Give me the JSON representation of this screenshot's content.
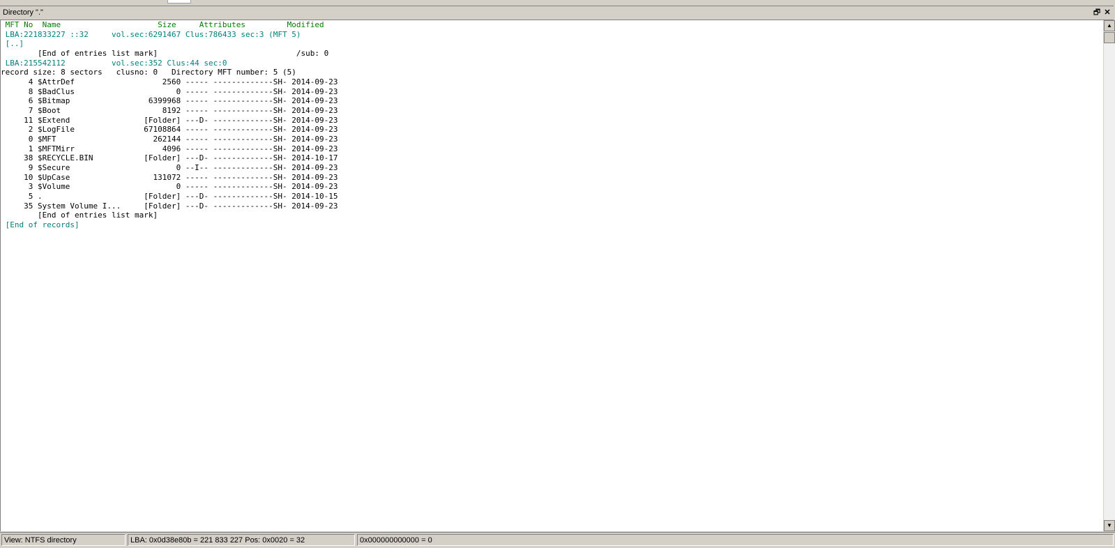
{
  "window": {
    "title": "Directory \".\"",
    "restore_glyph": "🗗",
    "close_glyph": "✕"
  },
  "listing": {
    "header": " MFT No  Name                     Size     Attributes         Modified",
    "lba_line1": " LBA:221833227 ::32     vol.sec:6291467 Clus:786433 sec:3 (MFT 5)",
    "parent": " [..]",
    "end_entries_1": "        [End of entries list mark]                              /sub: 0",
    "lba_line2": " LBA:215542112          vol.sec:352 Clus:44 sec:0",
    "record_info": "record size: 8 sectors   clusno: 0   Directory MFT number: 5 (5)",
    "rows": [
      {
        "text": "      4 $AttrDef                   2560 ----- -------------SH- 2014-09-23"
      },
      {
        "text": "      8 $BadClus                      0 ----- -------------SH- 2014-09-23"
      },
      {
        "text": "      6 $Bitmap                 6399968 ----- -------------SH- 2014-09-23"
      },
      {
        "text": "      7 $Boot                      8192 ----- -------------SH- 2014-09-23"
      },
      {
        "text": "     11 $Extend                [Folder] ---D- -------------SH- 2014-09-23"
      },
      {
        "text": "      2 $LogFile               67108864 ----- -------------SH- 2014-09-23"
      },
      {
        "text": "      0 $MFT                     262144 ----- -------------SH- 2014-09-23"
      },
      {
        "text": "      1 $MFTMirr                   4096 ----- -------------SH- 2014-09-23"
      },
      {
        "text": "     38 $RECYCLE.BIN           [Folder] ---D- -------------SH- 2014-10-17"
      },
      {
        "text": "      9 $Secure                       0 --I-- -------------SH- 2014-09-23"
      },
      {
        "text": "     10 $UpCase                  131072 ----- -------------SH- 2014-09-23"
      },
      {
        "text": "      3 $Volume                       0 ----- -------------SH- 2014-09-23"
      },
      {
        "text": "      5 .                      [Folder] ---D- -------------SH- 2014-10-15"
      },
      {
        "text": "     35 System Volume I...     [Folder] ---D- -------------SH- 2014-09-23"
      }
    ],
    "end_entries_2": "        [End of entries list mark]",
    "end_records": " [End of records]"
  },
  "scrollbar": {
    "up_glyph": "▲",
    "down_glyph": "▼"
  },
  "status": {
    "view": "View: NTFS directory",
    "lba": "LBA: 0x0d38e80b = 221 833 227  Pos: 0x0020 = 32",
    "value": "0x000000000000 = 0"
  },
  "colors": {
    "header": "#008000",
    "info": "#008080",
    "text": "#000000"
  }
}
